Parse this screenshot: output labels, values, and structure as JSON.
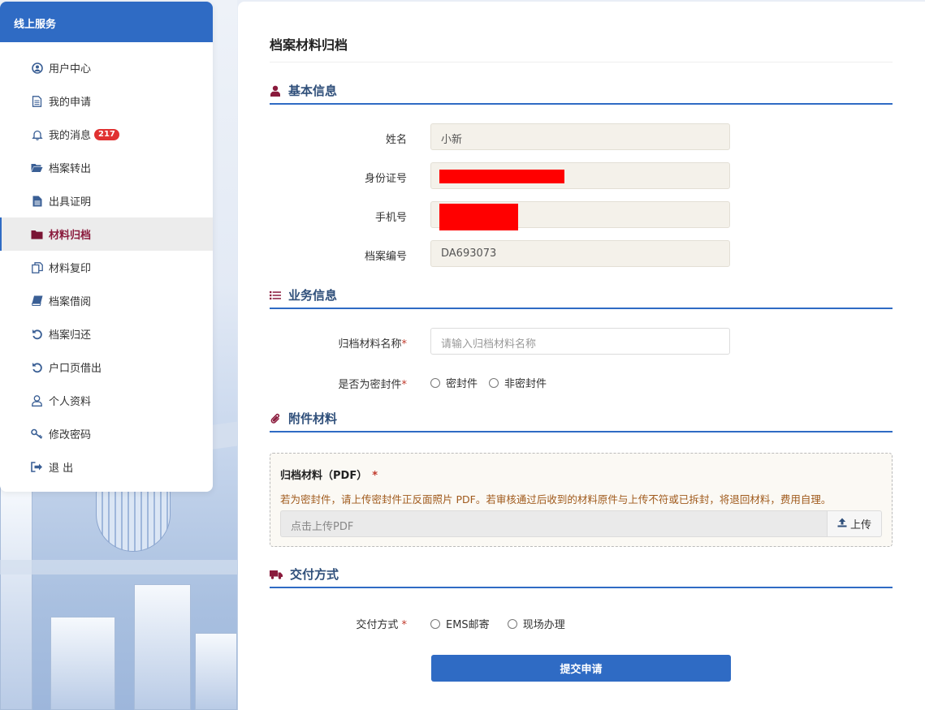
{
  "sidebar": {
    "title": "线上服务",
    "items": [
      {
        "label": "用户中心",
        "icon": "user-circle-icon"
      },
      {
        "label": "我的申请",
        "icon": "document-icon"
      },
      {
        "label": "我的消息",
        "icon": "bell-icon",
        "badge": "217"
      },
      {
        "label": "档案转出",
        "icon": "folder-open-icon"
      },
      {
        "label": "出具证明",
        "icon": "file-text-icon"
      },
      {
        "label": "材料归档",
        "icon": "folder-icon",
        "active": true
      },
      {
        "label": "材料复印",
        "icon": "copy-icon"
      },
      {
        "label": "档案借阅",
        "icon": "book-icon"
      },
      {
        "label": "档案归还",
        "icon": "undo-icon"
      },
      {
        "label": "户口页借出",
        "icon": "undo-icon"
      },
      {
        "label": "个人资料",
        "icon": "user-icon"
      },
      {
        "label": "修改密码",
        "icon": "key-icon"
      },
      {
        "label": "退 出",
        "icon": "sign-out-icon"
      }
    ]
  },
  "main": {
    "title": "档案材料归档",
    "basic": {
      "heading": "基本信息",
      "name_label": "姓名",
      "name_value": "小新",
      "id_label": "身份证号",
      "phone_label": "手机号",
      "file_no_label": "档案编号",
      "file_no_value": "DA693073"
    },
    "business": {
      "heading": "业务信息",
      "material_name_label": "归档材料名称",
      "material_name_placeholder": "请输入归档材料名称",
      "sealed_label": "是否为密封件",
      "sealed_options": [
        "密封件",
        "非密封件"
      ]
    },
    "attachment": {
      "heading": "附件材料",
      "box_title": "归档材料（PDF）",
      "note": "若为密封件，请上传密封件正反面照片 PDF。若审核通过后收到的材料原件与上传不符或已拆封，将退回材料，费用自理。",
      "upload_placeholder": "点击上传PDF",
      "upload_button": "上传"
    },
    "delivery": {
      "heading": "交付方式",
      "label": "交付方式",
      "options": [
        "EMS邮寄",
        "现场办理"
      ]
    },
    "required_mark": "*",
    "submit": "提交申请"
  },
  "colors": {
    "primary": "#2f6bc4",
    "accent": "#8a1a3c",
    "badge": "#e03131",
    "redaction": "#ff0000"
  }
}
